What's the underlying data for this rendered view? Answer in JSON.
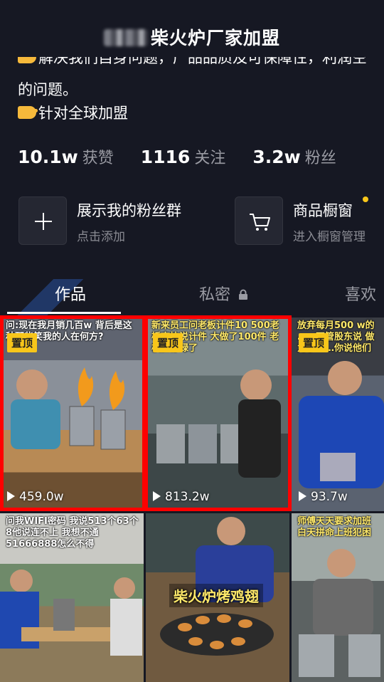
{
  "header": {
    "title": "柴火炉厂家加盟"
  },
  "bio": {
    "line1_cut": "解决我们自身问题，产品品质及可保障性，利润空间",
    "line2": "的问题。",
    "line3": "针对全球加盟"
  },
  "stats": [
    {
      "value": "10.1w",
      "label": "获赞"
    },
    {
      "value": "1116",
      "label": "关注"
    },
    {
      "value": "3.2w",
      "label": "粉丝"
    }
  ],
  "fan_group": {
    "title": "展示我的粉丝群",
    "subtitle": "点击添加"
  },
  "shop": {
    "title": "商品橱窗",
    "subtitle": "进入橱窗管理"
  },
  "tabs": [
    {
      "label": "作品"
    },
    {
      "label": "私密"
    },
    {
      "label": "喜欢"
    }
  ],
  "videos": [
    {
      "caption": "问:现在我月销几百w 背后是这种那些笑我的人在何方?",
      "pinned": "置顶",
      "plays": "459.0w"
    },
    {
      "caption": "新来员工问老板计件10 500老板爽快说计件 大做了100件 老板脸都绿了",
      "pinned": "置顶",
      "plays": "813.2w"
    },
    {
      "caption": "放弃每月500 w的 ……不管股东说 做为了……你说他们",
      "pinned": "置顶",
      "plays": "93.7w"
    },
    {
      "caption": "问我WIFI密码 我说513个63个8他说连不上 我想不通51666888怎么不得",
      "plays": ""
    },
    {
      "caption": "",
      "overlay": "柴火炉烤鸡翅",
      "plays": ""
    },
    {
      "caption": "师傅天天要求加班 白天拼命上班犯困",
      "plays": ""
    }
  ]
}
